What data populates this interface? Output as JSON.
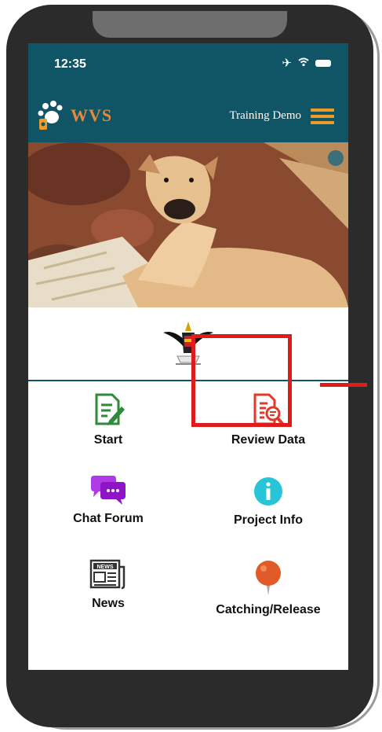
{
  "status_bar": {
    "time": "12:35",
    "icons": [
      "airplane-icon",
      "wifi-icon",
      "battery-icon"
    ]
  },
  "header": {
    "logo_text": "WVS",
    "title": "Training Demo",
    "menu_icon": "hamburger-menu-icon"
  },
  "menu": [
    {
      "label": "Start",
      "icon": "document-edit-icon",
      "color": "#2e8b3a"
    },
    {
      "label": "Review Data",
      "icon": "document-search-icon",
      "color": "#e03a2a"
    },
    {
      "label": "Chat Forum",
      "icon": "chat-bubbles-icon",
      "color": "#a21fd8"
    },
    {
      "label": "Project Info",
      "icon": "info-icon",
      "color": "#28c4d8"
    },
    {
      "label": "News",
      "icon": "newspaper-icon",
      "color": "#333333"
    },
    {
      "label": "Catching/Release",
      "icon": "map-pin-icon",
      "color": "#e05a2a"
    }
  ],
  "colors": {
    "brand": "#0f5566",
    "accent": "#f09a2a",
    "highlight": "#e01b1b"
  }
}
